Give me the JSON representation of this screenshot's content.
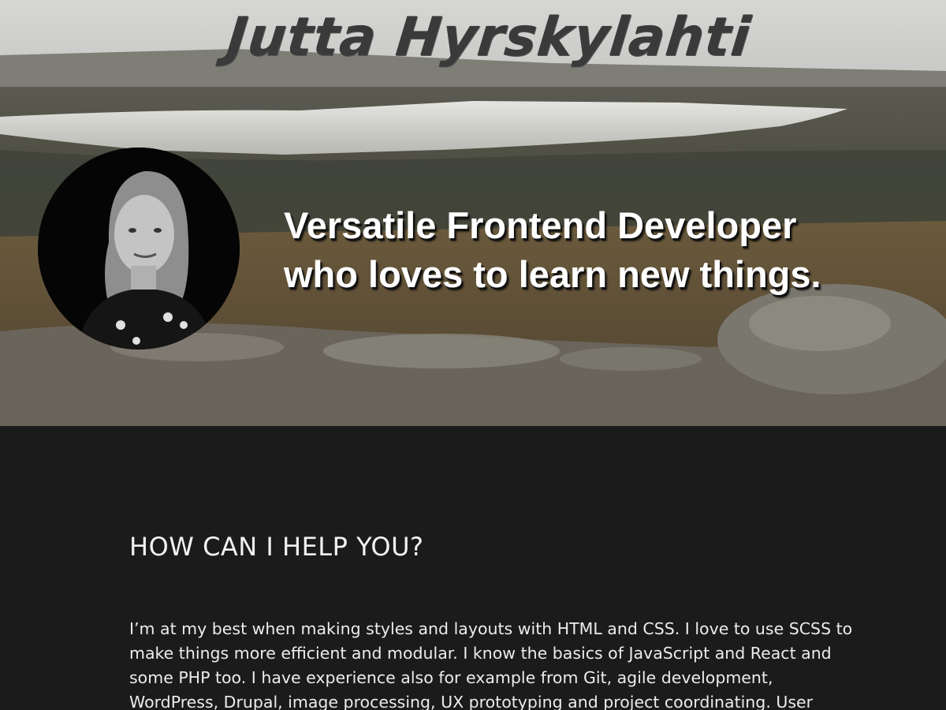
{
  "hero": {
    "title": "Jutta Hyrskylahti",
    "tagline_line1": "Versatile Frontend Developer",
    "tagline_line2": "who loves to learn new things.",
    "background_image": "mountain-lake-landscape",
    "portrait_image": "black-and-white-portrait"
  },
  "section": {
    "heading": "HOW CAN I HELP YOU?",
    "body": "I’m at my best when making styles and layouts with HTML and CSS. I love to use SCSS to make things more efficient and modular. I know the basics of JavaScript and React and some PHP too. I have experience also for example from Git, agile development, WordPress, Drupal, image processing, UX prototyping and project coordinating. User"
  },
  "colors": {
    "title": "#3a3a3a",
    "tagline": "#ffffff",
    "content_background": "#1b1b1b",
    "content_text": "#ececec"
  }
}
